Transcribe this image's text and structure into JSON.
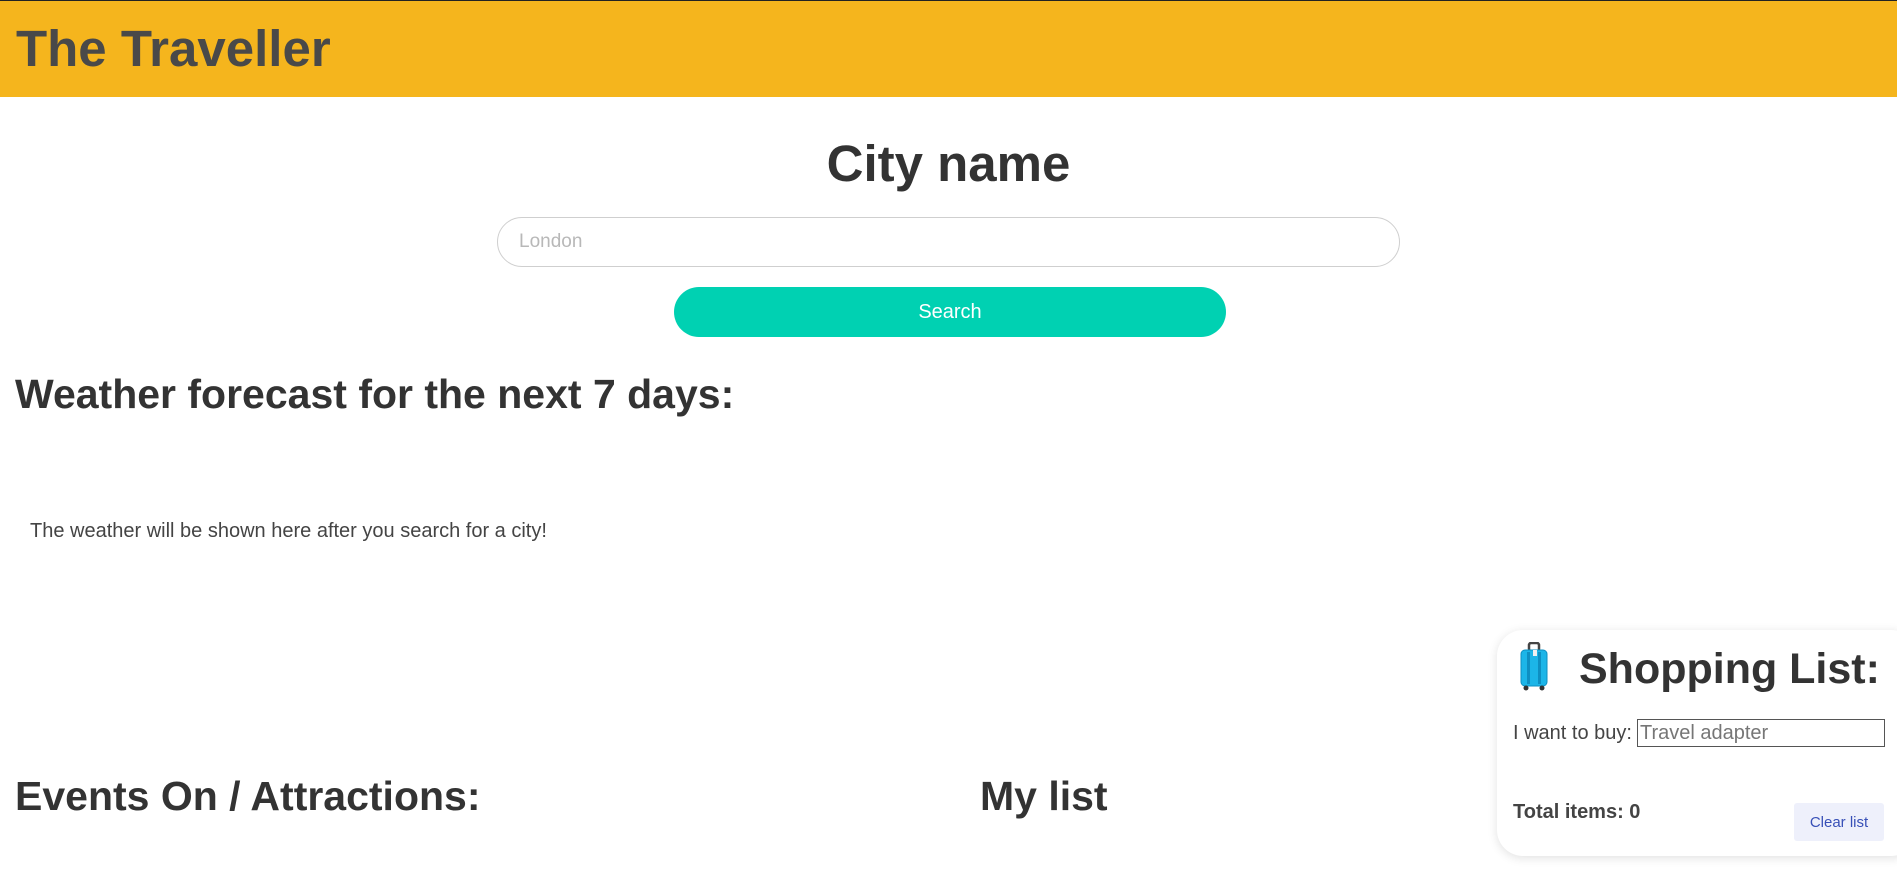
{
  "header": {
    "brand": "The Traveller"
  },
  "search": {
    "title": "City name",
    "placeholder": "London",
    "button_label": "Search"
  },
  "weather": {
    "title": "Weather forecast for the next 7 days:",
    "message": "The weather will be shown here after you search for a city!"
  },
  "events": {
    "title": "Events On / Attractions:"
  },
  "my_list": {
    "title": "My list"
  },
  "shopping": {
    "icon": "suitcase-icon",
    "title": "Shopping List:",
    "buy_label": "I want to buy:",
    "buy_placeholder": "Travel adapter",
    "total_label": "Total items: 0",
    "clear_label": "Clear list"
  },
  "colors": {
    "header_bg": "#f5b51d",
    "accent": "#00d1b2",
    "clear_bg": "#eef0fb",
    "clear_text": "#3850b7"
  }
}
